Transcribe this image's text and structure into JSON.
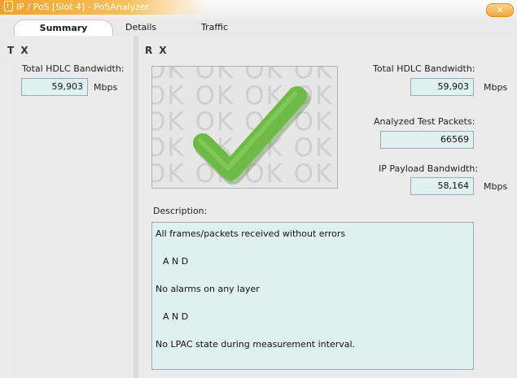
{
  "window": {
    "title": "IP / PoS [Slot 4]  -  PoSAnalyzer",
    "close_label": "✕"
  },
  "tabs": [
    {
      "label": "Summary",
      "active": true
    },
    {
      "label": "Details",
      "active": false
    },
    {
      "label": "Traffic",
      "active": false
    }
  ],
  "tx": {
    "header": "T X",
    "total_hdlc_label": "Total HDLC Bandwidth:",
    "total_hdlc_value": "59,903",
    "unit": "Mbps"
  },
  "rx": {
    "header": "R X",
    "ok_text": "OK",
    "total_hdlc_label": "Total HDLC Bandwidth:",
    "total_hdlc_value": "59,903",
    "analyzed_label": "Analyzed Test Packets:",
    "analyzed_value": "66569",
    "payload_label": "IP Payload Bandwidth:",
    "payload_value": "58,164",
    "unit": "Mbps",
    "description_label": "Description:",
    "description_lines": [
      "All frames/packets received without errors",
      "A N D",
      "No alarms on any layer",
      "A N D",
      "No LPAC state during measurement interval."
    ]
  },
  "colors": {
    "accent": "#f4a83a",
    "check": "#6dbb46",
    "value_bg": "#dff0ef"
  },
  "icons": {
    "title": "window-icon",
    "check": "checkmark-icon"
  }
}
